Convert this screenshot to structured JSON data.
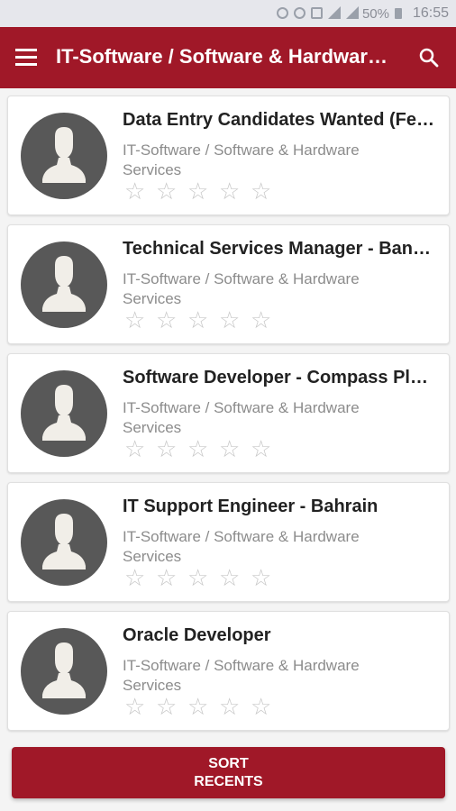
{
  "status_bar": {
    "battery_percent": "50%",
    "time": "16:55",
    "icons": [
      "alarm-icon",
      "wifi-icon",
      "sim-icon",
      "signal-icon",
      "signal-icon",
      "battery-icon"
    ]
  },
  "app_bar": {
    "title": "IT-Software / Software & Hardware Services",
    "menu_icon": "menu-icon",
    "search_icon": "search-icon"
  },
  "jobs": [
    {
      "title": "Data Entry Candidates Wanted (Fe…",
      "category": "IT-Software / Software & Hardware Services",
      "rating": 0,
      "max_rating": 5
    },
    {
      "title": "Technical Services Manager - Ban…",
      "category": "IT-Software / Software & Hardware Services",
      "rating": 0,
      "max_rating": 5
    },
    {
      "title": "Software Developer - Compass Pl…",
      "category": "IT-Software / Software & Hardware Services",
      "rating": 0,
      "max_rating": 5
    },
    {
      "title": "IT Support Engineer - Bahrain",
      "category": "IT-Software / Software & Hardware Services",
      "rating": 0,
      "max_rating": 5
    },
    {
      "title": "Oracle Developer",
      "category": "IT-Software / Software & Hardware Services",
      "rating": 0,
      "max_rating": 5
    }
  ],
  "sort_button": {
    "line1": "SORT",
    "line2": "RECENTS"
  },
  "colors": {
    "primary": "#a01828",
    "avatar_bg": "#585858",
    "avatar_fg": "#f1eee8",
    "star_empty": "#c8c8c8"
  }
}
